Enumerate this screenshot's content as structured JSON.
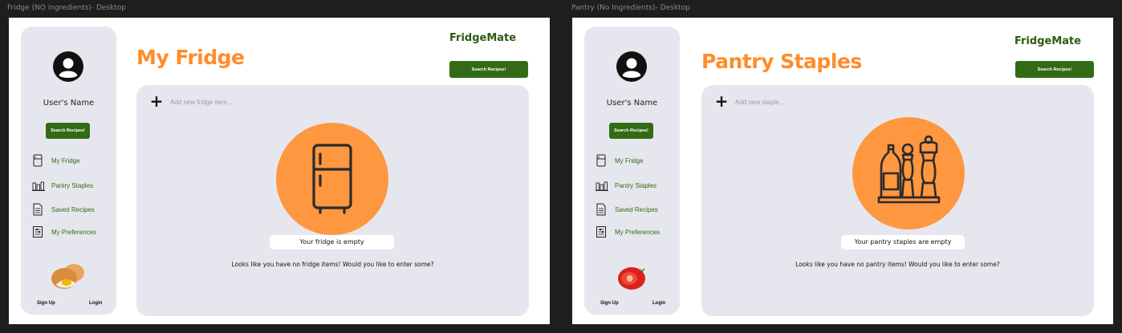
{
  "canvas": {
    "background": "#1e1e1e"
  },
  "colors": {
    "brand_green": "#336a16",
    "title_orange": "#ff8c2a",
    "circle_orange": "#ff9640",
    "panel_gray": "#e6e7ee"
  },
  "frames": {
    "fridge": {
      "label": "Fridge (NO ingredients)- Desktop",
      "sidebar": {
        "avatar_icon": "user-avatar-icon",
        "user_name": "User's Name",
        "search_button": "Search Recipes!",
        "nav": [
          {
            "label": "My Fridge",
            "icon": "fridge-icon"
          },
          {
            "label": "Pantry Staples",
            "icon": "pantry-shelf-icon"
          },
          {
            "label": "Saved Recipes",
            "icon": "document-icon"
          },
          {
            "label": "My Preferences",
            "icon": "sliders-icon"
          }
        ],
        "decoration_icon": "egg-icon",
        "sign_up": "Sign Up",
        "login": "Login"
      },
      "brand": "FridgeMate",
      "title": "My Fridge",
      "top_button": "Search Recipes!",
      "panel": {
        "add_icon": "plus-icon",
        "add_placeholder": "Add new fridge item...",
        "illustration": "refrigerator-icon",
        "empty_label": "Your fridge is empty",
        "hint": "Looks like you have no fridge items! Would you like to enter some?"
      }
    },
    "pantry": {
      "label": "Pantry (No Ingredients)- Desktop",
      "sidebar": {
        "avatar_icon": "user-avatar-icon",
        "user_name": "User's Name",
        "search_button": "Search Recipes!",
        "nav": [
          {
            "label": "My Fridge",
            "icon": "fridge-icon"
          },
          {
            "label": "Pantry Staples",
            "icon": "pantry-shelf-icon"
          },
          {
            "label": "Saved Recipes",
            "icon": "document-icon"
          },
          {
            "label": "My Preferences",
            "icon": "sliders-icon"
          }
        ],
        "decoration_icon": "tomato-icon",
        "sign_up": "Sign Up",
        "login": "Login"
      },
      "brand": "FridgeMate",
      "title": "Pantry Staples",
      "top_button": "Search Recipes!",
      "panel": {
        "add_icon": "plus-icon",
        "add_placeholder": "Add new staple...",
        "illustration": "spice-bottles-icon",
        "empty_label": "Your pantry staples are empty",
        "hint": "Looks like you have no pantry items! Would you like to enter some?"
      }
    }
  }
}
